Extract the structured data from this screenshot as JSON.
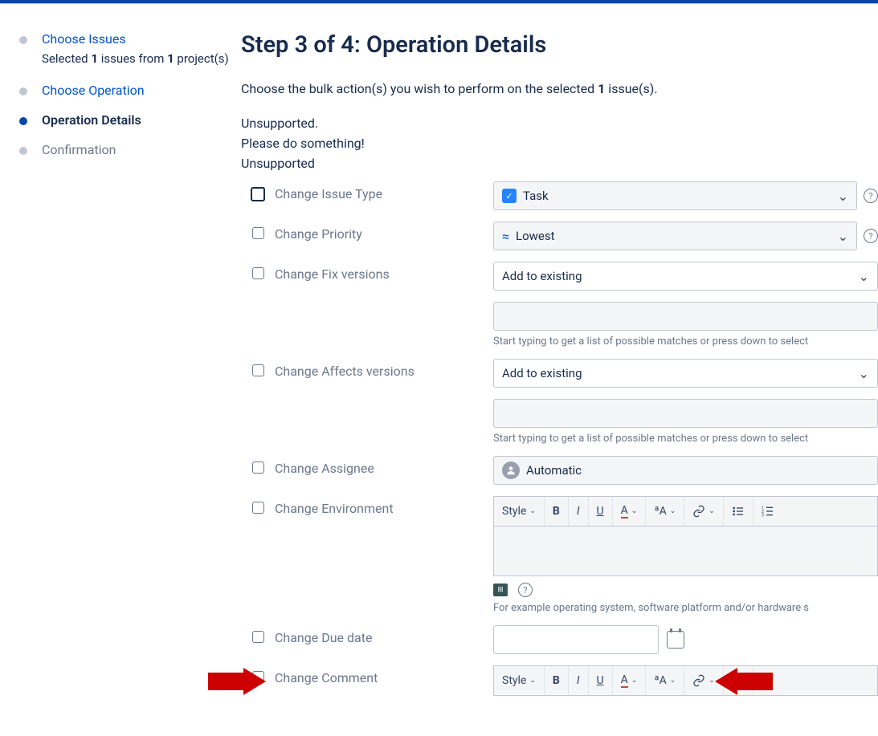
{
  "steps": {
    "s1": {
      "title": "Choose Issues",
      "sub_prefix": "Selected ",
      "issues": "1",
      "sub_mid": " issues from ",
      "projects": "1",
      "sub_suffix": " project(s)"
    },
    "s2": {
      "title": "Choose Operation"
    },
    "s3": {
      "title": "Operation Details"
    },
    "s4": {
      "title": "Confirmation"
    }
  },
  "heading": "Step 3 of 4: Operation Details",
  "desc_prefix": "Choose the bulk action(s) you wish to perform on the selected ",
  "desc_count": "1",
  "desc_suffix": " issue(s).",
  "msgs": {
    "l1": "Unsupported.",
    "l2": "Please do something!",
    "l3": "Unsupported"
  },
  "fields": {
    "issuetype": {
      "label": "Change Issue Type",
      "value": "Task"
    },
    "priority": {
      "label": "Change Priority",
      "value": "Lowest"
    },
    "fixversions": {
      "label": "Change Fix versions",
      "mode": "Add to existing",
      "hint": "Start typing to get a list of possible matches or press down to select"
    },
    "affects": {
      "label": "Change Affects versions",
      "mode": "Add to existing",
      "hint": "Start typing to get a list of possible matches or press down to select"
    },
    "assignee": {
      "label": "Change Assignee",
      "value": "Automatic"
    },
    "environment": {
      "label": "Change Environment",
      "hint": "For example operating system, software platform and/or hardware s"
    },
    "duedate": {
      "label": "Change Due date"
    },
    "comment": {
      "label": "Change Comment"
    }
  },
  "toolbar": {
    "style": "Style",
    "b": "B",
    "i": "I",
    "u": "U",
    "a": "A",
    "aa": "ªA"
  }
}
